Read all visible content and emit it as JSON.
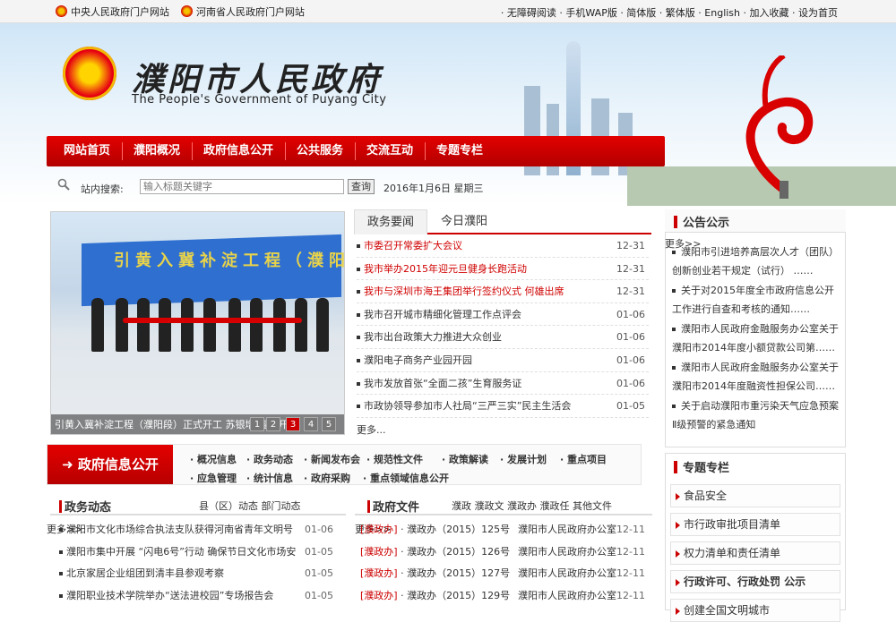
{
  "topbar": {
    "left_links": [
      "中央人民政府门户网站",
      "河南省人民政府门户网站"
    ],
    "right_links": "· 无障碍阅读 · 手机WAP版 · 简体版 · 繁体版 · English · 加入收藏 · 设为首页"
  },
  "banner": {
    "title": "濮阳市人民政府",
    "subtitle": "The People's Government of Puyang City"
  },
  "nav": {
    "items": [
      "网站首页",
      "濮阳概况",
      "政府信息公开",
      "公共服务",
      "交流互动",
      "专题专栏"
    ]
  },
  "search": {
    "label": "站内搜索:",
    "placeholder": "输入标题关键字",
    "button": "查询",
    "date": "2016年1月6日  星期三"
  },
  "photo": {
    "banner_text": "引黄入冀补淀工程（濮阳",
    "caption": "引黄入冀补淀工程（濮阳段）正式开工 苏银增 宣布开工",
    "slides": [
      "1",
      "2",
      "3",
      "4",
      "5"
    ]
  },
  "news": {
    "tabs": [
      "政务要闻",
      "今日濮阳"
    ],
    "items": [
      {
        "title": "市委召开常委扩大会议",
        "date": "12-31",
        "red": true
      },
      {
        "title": "我市举办2015年迎元旦健身长跑活动",
        "date": "12-31",
        "red": true
      },
      {
        "title": "我市与深圳市海王集团举行签约仪式 何雄出席",
        "date": "12-31",
        "red": true
      },
      {
        "title": "我市召开城市精细化管理工作点评会",
        "date": "01-06",
        "red": false
      },
      {
        "title": "我市出台政策大力推进大众创业",
        "date": "01-06",
        "red": false
      },
      {
        "title": "濮阳电子商务产业园开园",
        "date": "01-06",
        "red": false
      },
      {
        "title": "我市发放首张“全面二孩”生育服务证",
        "date": "01-06",
        "red": false
      },
      {
        "title": "市政协领导参加市人社局“三严三实”民主生活会",
        "date": "01-05",
        "red": false
      }
    ],
    "more": "更多..."
  },
  "notice": {
    "title": "公告公示",
    "more": "更多>>",
    "items": [
      "濮阳市引进培养高层次人才（团队）创新创业若干规定（试行） ……",
      "关于对2015年度全市政府信息公开工作进行自查和考核的通知……",
      "濮阳市人民政府金融服务办公室关于濮阳市2014年度小额贷款公司第……",
      "濮阳市人民政府金融服务办公室关于濮阳市2014年度融资性担保公司……",
      "关于启动濮阳市重污染天气应急预案Ⅱ级预警的紧急通知"
    ]
  },
  "opengov": {
    "button": "政府信息公开",
    "row1": [
      "概况信息",
      "政务动态",
      "新闻发布会",
      "规范性文件",
      "政策解读",
      "发展计划",
      "重点项目"
    ],
    "row2": [
      "应急管理",
      "统计信息",
      "政府采购",
      "重点领域信息公开"
    ]
  },
  "zhuanti": {
    "title": "专题专栏",
    "items": [
      "食品安全",
      "市行政审批项目清单",
      "权力清单和责任清单",
      "行政许可、行政处罚 公示",
      "创建全国文明城市"
    ]
  },
  "zwdt": {
    "title": "政务动态",
    "sub": "县（区）动态  部门动态",
    "more": "更多>>",
    "items": [
      {
        "title": "濮阳市文化市场综合执法支队获得河南省青年文明号",
        "date": "01-06"
      },
      {
        "title": "濮阳市集中开展 “闪电6号”行动 确保节日文化市场安",
        "date": "01-05"
      },
      {
        "title": "北京家居企业组团到清丰县参观考察",
        "date": "01-05"
      },
      {
        "title": "濮阳职业技术学院举办“送法进校园”专场报告会",
        "date": "01-05"
      }
    ]
  },
  "zfwj": {
    "title": "政府文件",
    "sub": "濮政  濮政文  濮政办  濮政任  其他文件",
    "more": "更多>>",
    "items": [
      {
        "tag": "[濮政办]",
        "num": "濮政办（2015）125号",
        "org": "濮阳市人民政府办公室",
        "date": "12-11"
      },
      {
        "tag": "[濮政办]",
        "num": "濮政办（2015）126号",
        "org": "濮阳市人民政府办公室",
        "date": "12-11"
      },
      {
        "tag": "[濮政办]",
        "num": "濮政办（2015）127号",
        "org": "濮阳市人民政府办公室",
        "date": "12-11"
      },
      {
        "tag": "[濮政办]",
        "num": "濮政办（2015）129号",
        "org": "濮阳市人民政府办公室",
        "date": "12-11"
      }
    ]
  }
}
